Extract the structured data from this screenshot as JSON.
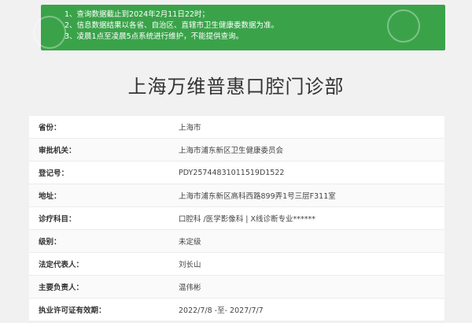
{
  "notice": {
    "lines": [
      "1、查询数据截止到2024年2月11日22时；",
      "2、信息数据结果以各省、自治区、直辖市卫生健康委数据为准。",
      "3、凌晨1点至凌晨5点系统进行维护，不能提供查询。"
    ]
  },
  "title": "上海万维普惠口腔门诊部",
  "rows": [
    {
      "label": "省份：",
      "value": "上海市"
    },
    {
      "label": "审批机关：",
      "value": "上海市浦东新区卫生健康委员会"
    },
    {
      "label": "登记号：",
      "value": "PDY25744831011519D1522"
    },
    {
      "label": "地址：",
      "value": "上海市浦东新区高科西路899弄1号三层F311室"
    },
    {
      "label": "诊疗科目：",
      "value": "口腔科 /医学影像科 | X线诊断专业******"
    },
    {
      "label": "级别：",
      "value": "未定级"
    },
    {
      "label": "法定代表人：",
      "value": "刘长山"
    },
    {
      "label": "主要负责人：",
      "value": "温伟彬"
    },
    {
      "label": "执业许可证有效期：",
      "value": "2022/7/8 -至- 2027/7/7"
    }
  ]
}
